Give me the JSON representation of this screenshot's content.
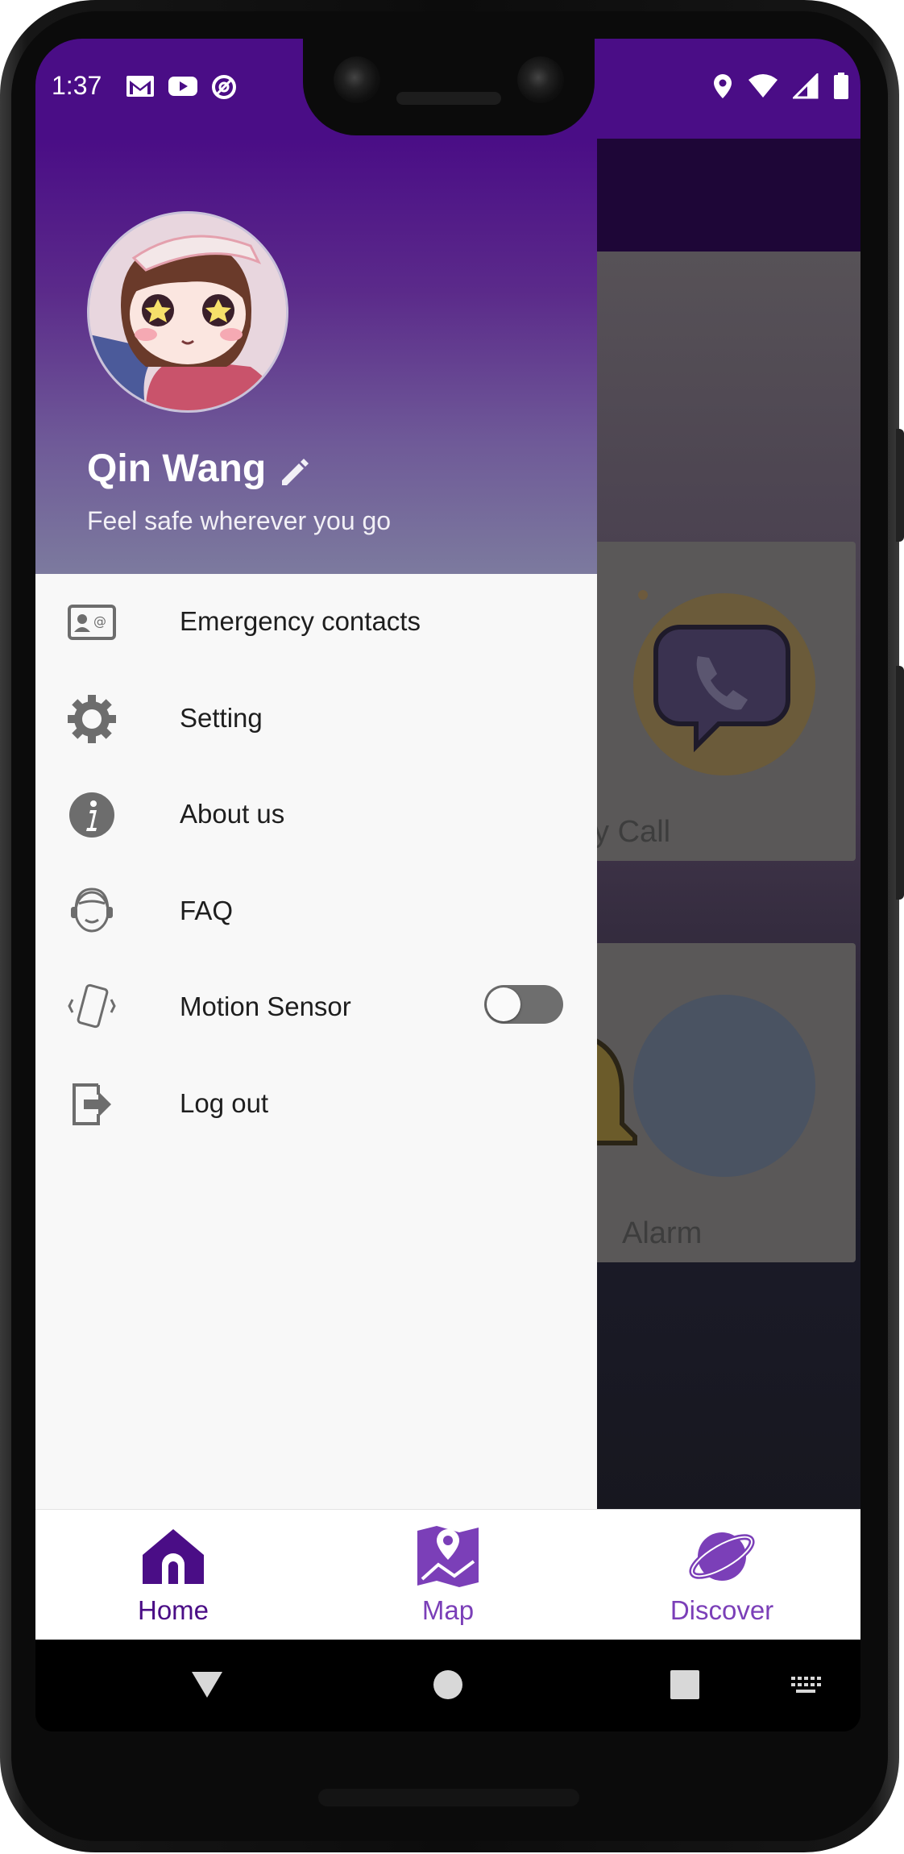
{
  "status_bar": {
    "time": "1:37",
    "left_icons": [
      "gmail-icon",
      "youtube-icon",
      "do-not-disturb-icon"
    ],
    "right_icons": [
      "location-icon",
      "wifi-icon",
      "cellular-signal-icon",
      "battery-icon"
    ]
  },
  "drawer": {
    "profile": {
      "name": "Qin Wang",
      "tagline": "Feel safe wherever you go",
      "edit_icon": "pencil-icon"
    },
    "menu_items": [
      {
        "label": "Emergency contacts",
        "icon": "contact-card-icon"
      },
      {
        "label": "Setting",
        "icon": "gear-icon"
      },
      {
        "label": "About us",
        "icon": "info-icon"
      },
      {
        "label": "FAQ",
        "icon": "support-agent-icon"
      },
      {
        "label": "Motion Sensor",
        "icon": "phone-vibrate-icon",
        "toggle_on": false
      },
      {
        "label": "Log out",
        "icon": "logout-icon"
      }
    ]
  },
  "background_screen": {
    "cards": [
      {
        "label": "rgency Call",
        "icon": "call-bubble-icon"
      },
      {
        "label": "Alarm",
        "icon": "bell-icon"
      }
    ]
  },
  "bottom_nav": {
    "items": [
      {
        "label": "Home",
        "icon": "home-icon",
        "active": true
      },
      {
        "label": "Map",
        "icon": "map-pin-icon",
        "active": false
      },
      {
        "label": "Discover",
        "icon": "planet-icon",
        "active": false
      }
    ]
  },
  "colors": {
    "primary_purple": "#4a0d86",
    "accent_purple": "#7b3fb8",
    "drawer_bg": "#f8f8f8",
    "toggle_track": "#6e6e6e"
  }
}
